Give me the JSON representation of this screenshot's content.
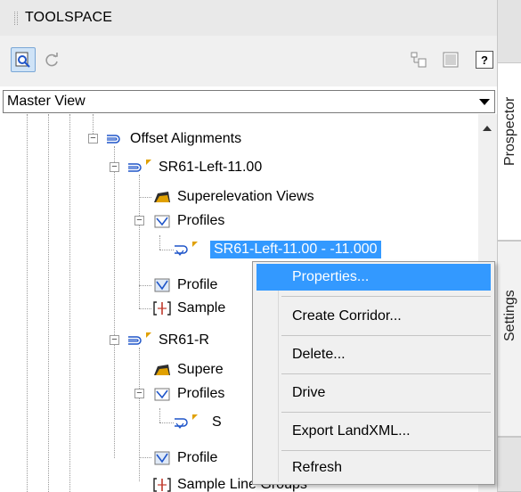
{
  "window": {
    "title": "TOOLSPACE"
  },
  "toolbar": {
    "help_label": "?"
  },
  "view_selector": {
    "selected": "Master View"
  },
  "tree": {
    "offset_alignments": "Offset Alignments",
    "left_alignment": "SR61-Left-11.00",
    "left_superelevation_views": "Superelevation Views",
    "left_profiles": "Profiles",
    "left_profile_selected": "SR61-Left-11.00 - -11.000",
    "left_profile_views": "Profile",
    "left_sample_line_groups": "Sample",
    "right_alignment": "SR61-R",
    "right_superelevation_views": "Supere",
    "right_profiles": "Profiles",
    "right_profile_child": "S",
    "right_profile_views": "Profile",
    "right_sample_line_groups": "Sample Line Groups"
  },
  "context_menu": {
    "items": [
      "Properties...",
      "Create Corridor...",
      "Delete...",
      "Drive",
      "Export LandXML...",
      "Refresh"
    ],
    "highlighted": "Properties..."
  },
  "side_tabs": {
    "prospector": "Prospector",
    "settings": "Settings"
  },
  "colors": {
    "selection": "#3399ff",
    "marker": "#e0a000",
    "icon_blue": "#1f55c9"
  }
}
